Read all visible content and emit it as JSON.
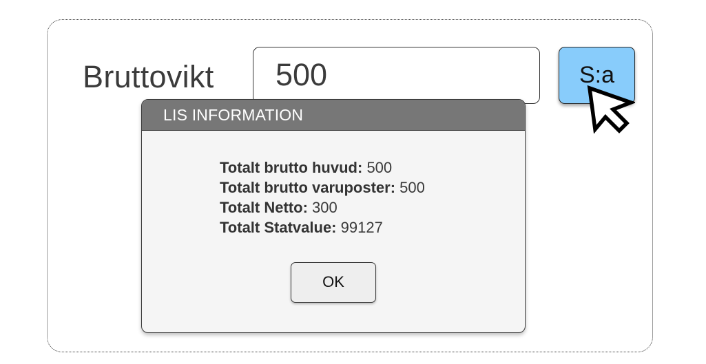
{
  "form": {
    "field_label": "Bruttovikt",
    "field_value": "500",
    "sum_button_label": "S:a"
  },
  "dialog": {
    "title": "LIS INFORMATION",
    "lines": [
      {
        "label": "Totalt brutto huvud:",
        "value": " 500"
      },
      {
        "label": "Totalt brutto varuposter:",
        "value": " 500"
      },
      {
        "label": "Totalt Netto:",
        "value": " 300"
      },
      {
        "label": "Totalt Statvalue:",
        "value": " 99127"
      }
    ],
    "ok_label": "OK"
  },
  "colors": {
    "accent_button": "#88ccfb",
    "dialog_header": "#777777",
    "dialog_body": "#f5f5f5"
  },
  "icons": {
    "cursor": "arrow-pointer-icon"
  }
}
